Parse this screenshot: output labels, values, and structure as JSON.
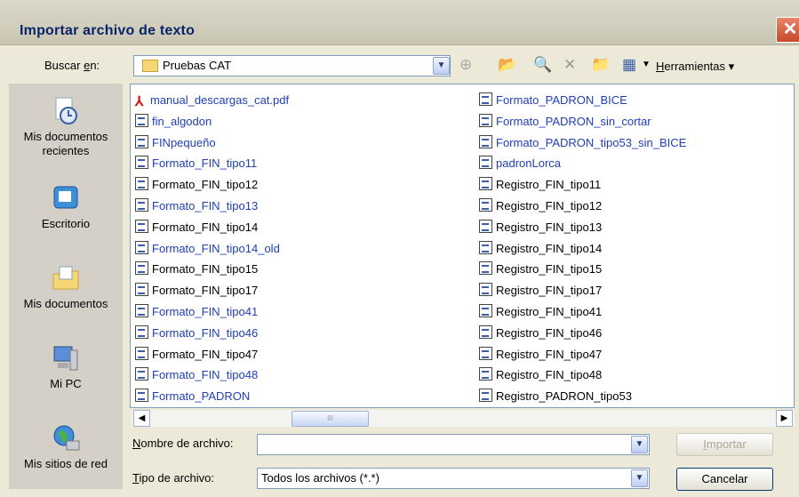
{
  "dialog": {
    "title": "Importar archivo de texto",
    "close_symbol": "✕"
  },
  "lookin": {
    "label_pre": "Buscar ",
    "label_u": "e",
    "label_post": "n:",
    "value": "Pruebas CAT"
  },
  "toolbar": {
    "back": "⊕",
    "up": "📂",
    "search": "🔍",
    "delete": "✕",
    "newfolder": "📁",
    "views": "▦",
    "tools_u": "H",
    "tools_rest": "erramientas"
  },
  "places": [
    {
      "label": "Mis documentos recientes"
    },
    {
      "label": "Escritorio"
    },
    {
      "label": "Mis documentos"
    },
    {
      "label": "Mi PC"
    },
    {
      "label": "Mis sitios de red"
    }
  ],
  "files_left": [
    {
      "name": "manual_descargas_cat.pdf",
      "type": "pdf",
      "blue": true
    },
    {
      "name": "fin_algodon",
      "type": "txt",
      "blue": true
    },
    {
      "name": "FINpequeño",
      "type": "txt",
      "blue": true
    },
    {
      "name": "Formato_FIN_tipo11",
      "type": "txt",
      "blue": true
    },
    {
      "name": "Formato_FIN_tipo12",
      "type": "txt",
      "blue": false
    },
    {
      "name": "Formato_FIN_tipo13",
      "type": "txt",
      "blue": true
    },
    {
      "name": "Formato_FIN_tipo14",
      "type": "txt",
      "blue": false
    },
    {
      "name": "Formato_FIN_tipo14_old",
      "type": "txt",
      "blue": true
    },
    {
      "name": "Formato_FIN_tipo15",
      "type": "txt",
      "blue": false
    },
    {
      "name": "Formato_FIN_tipo17",
      "type": "txt",
      "blue": false
    },
    {
      "name": "Formato_FIN_tipo41",
      "type": "txt",
      "blue": true
    },
    {
      "name": "Formato_FIN_tipo46",
      "type": "txt",
      "blue": true
    },
    {
      "name": "Formato_FIN_tipo47",
      "type": "txt",
      "blue": false
    },
    {
      "name": "Formato_FIN_tipo48",
      "type": "txt",
      "blue": true
    },
    {
      "name": "Formato_PADRON",
      "type": "txt",
      "blue": true
    }
  ],
  "files_right": [
    {
      "name": "Formato_PADRON_BICE",
      "type": "txt",
      "blue": true
    },
    {
      "name": "Formato_PADRON_sin_cortar",
      "type": "txt",
      "blue": true
    },
    {
      "name": "Formato_PADRON_tipo53_sin_BICE",
      "type": "txt",
      "blue": true
    },
    {
      "name": "padronLorca",
      "type": "txt",
      "blue": true
    },
    {
      "name": "Registro_FIN_tipo11",
      "type": "txt",
      "blue": false
    },
    {
      "name": "Registro_FIN_tipo12",
      "type": "txt",
      "blue": false
    },
    {
      "name": "Registro_FIN_tipo13",
      "type": "txt",
      "blue": false
    },
    {
      "name": "Registro_FIN_tipo14",
      "type": "txt",
      "blue": false
    },
    {
      "name": "Registro_FIN_tipo15",
      "type": "txt",
      "blue": false
    },
    {
      "name": "Registro_FIN_tipo17",
      "type": "txt",
      "blue": false
    },
    {
      "name": "Registro_FIN_tipo41",
      "type": "txt",
      "blue": false
    },
    {
      "name": "Registro_FIN_tipo46",
      "type": "txt",
      "blue": false
    },
    {
      "name": "Registro_FIN_tipo47",
      "type": "txt",
      "blue": false
    },
    {
      "name": "Registro_FIN_tipo48",
      "type": "txt",
      "blue": false
    },
    {
      "name": "Registro_PADRON_tipo53",
      "type": "txt",
      "blue": false
    }
  ],
  "filename": {
    "label_u": "N",
    "label_rest": "ombre de archivo:",
    "value": ""
  },
  "filetype": {
    "label_u": "T",
    "label_rest": "ipo de archivo:",
    "value": "Todos los archivos (*.*)"
  },
  "buttons": {
    "import_u": "I",
    "import_rest": "mportar",
    "cancel": "Cancelar"
  },
  "scroll": {
    "thumb_grip": "III",
    "left": "◀",
    "right": "▶"
  },
  "colors": {
    "link_blue": "#1f3fb5",
    "title_blue": "#0a246a"
  }
}
